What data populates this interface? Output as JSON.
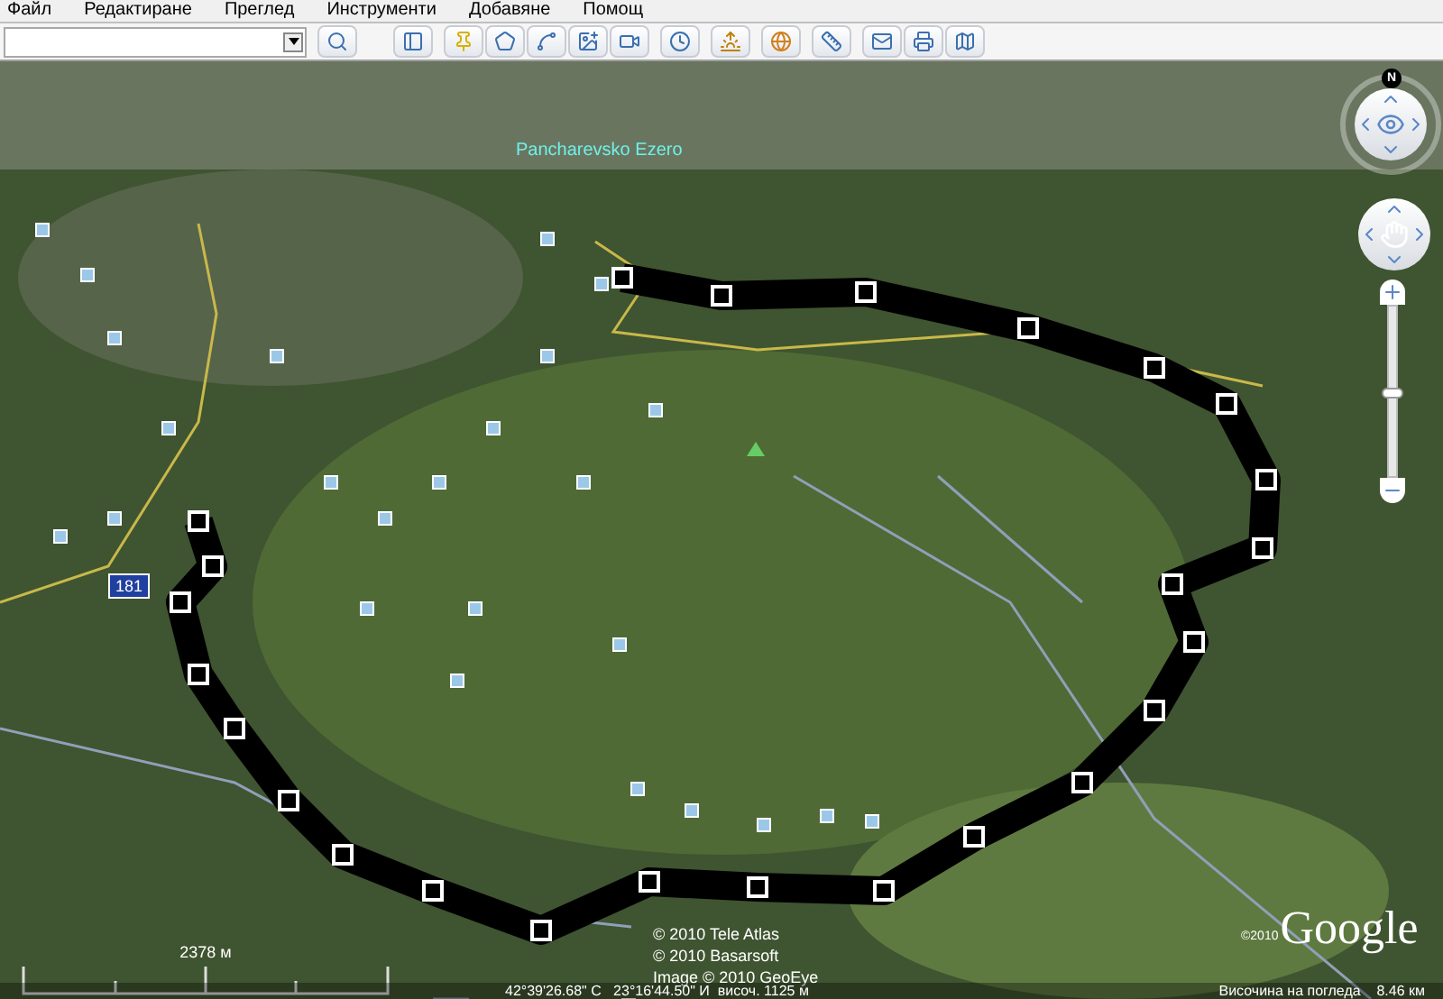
{
  "menu": [
    {
      "label": "Файл"
    },
    {
      "label": "Редактиране"
    },
    {
      "label": "Преглед"
    },
    {
      "label": "Инструменти"
    },
    {
      "label": "Добавяне"
    },
    {
      "label": "Помощ"
    }
  ],
  "map": {
    "place_label": "Pancharevsko Ezero",
    "road_shield": "181",
    "scale": "2378 м",
    "attributions": [
      "© 2010 Tele Atlas",
      "© 2010 Basarsoft",
      "Image © 2010 GeoEye"
    ],
    "logo_year": "©2010",
    "logo": "Google",
    "compass": "N"
  },
  "zoom": {
    "level": 0.5
  },
  "status": {
    "pointer": "42°39'26.68\" С   23°16'44.50\" И  височ. 1125 м",
    "eye_altitude": "Височина на погледа    8.46 км"
  }
}
